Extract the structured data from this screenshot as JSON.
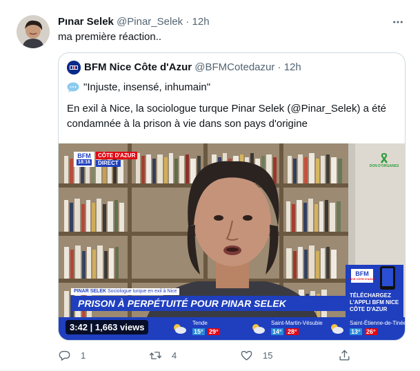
{
  "tweet": {
    "author_name": "Pınar Selek",
    "author_handle": "@Pinar_Selek",
    "separator": "·",
    "time": "12h",
    "text": "ma première réaction..",
    "more_icon": "more-horizontal-icon"
  },
  "quoted": {
    "author_name": "BFM Nice Côte d'Azur",
    "author_handle": "@BFMCotedazur",
    "separator": "·",
    "time": "12h",
    "line1": "\"Injuste, insensé, inhumain\"",
    "body": "En exil à Nice, la sociologue turque Pinar Selek (@Pinar_Selek) a été condamnée à la prison à vie dans son pays d'origine",
    "speech_icon": "speech-balloon-icon"
  },
  "video": {
    "badge": "3:42 | 1,663 views",
    "logo_text": "BFM",
    "logo_time": "18:16",
    "channel_label": "CÔTE D'AZUR",
    "live_label": "DIRECT",
    "lower_third_name": "PINAR SELEK",
    "lower_third_role": "Sociologue turque en exil à Nice",
    "headline": "PRISON À PERPÉTUITÉ POUR PINAR SELEK",
    "promo_logo": "BFM",
    "promo_sub": "NICE CÔTE D'AZUR",
    "promo_text": "TÉLÉCHARGEZ L'APPLI BFM NICE CÔTE D'AZUR",
    "ribbon_text": "DON D'ORGANES",
    "weather": [
      {
        "city": "Tende",
        "min": "15°",
        "max": "29°"
      },
      {
        "city": "Saint-Martin-Vésubie",
        "min": "14°",
        "max": "28°"
      },
      {
        "city": "Saint-Étienne-de-Tinée",
        "min": "13°",
        "max": "26°"
      }
    ]
  },
  "actions": {
    "reply_count": "1",
    "retweet_count": "4",
    "like_count": "15"
  },
  "colors": {
    "accent_blue": "#1d9bf0",
    "bfm_blue": "#1f3fbf",
    "bfm_red": "#e30613",
    "muted": "#536471"
  }
}
